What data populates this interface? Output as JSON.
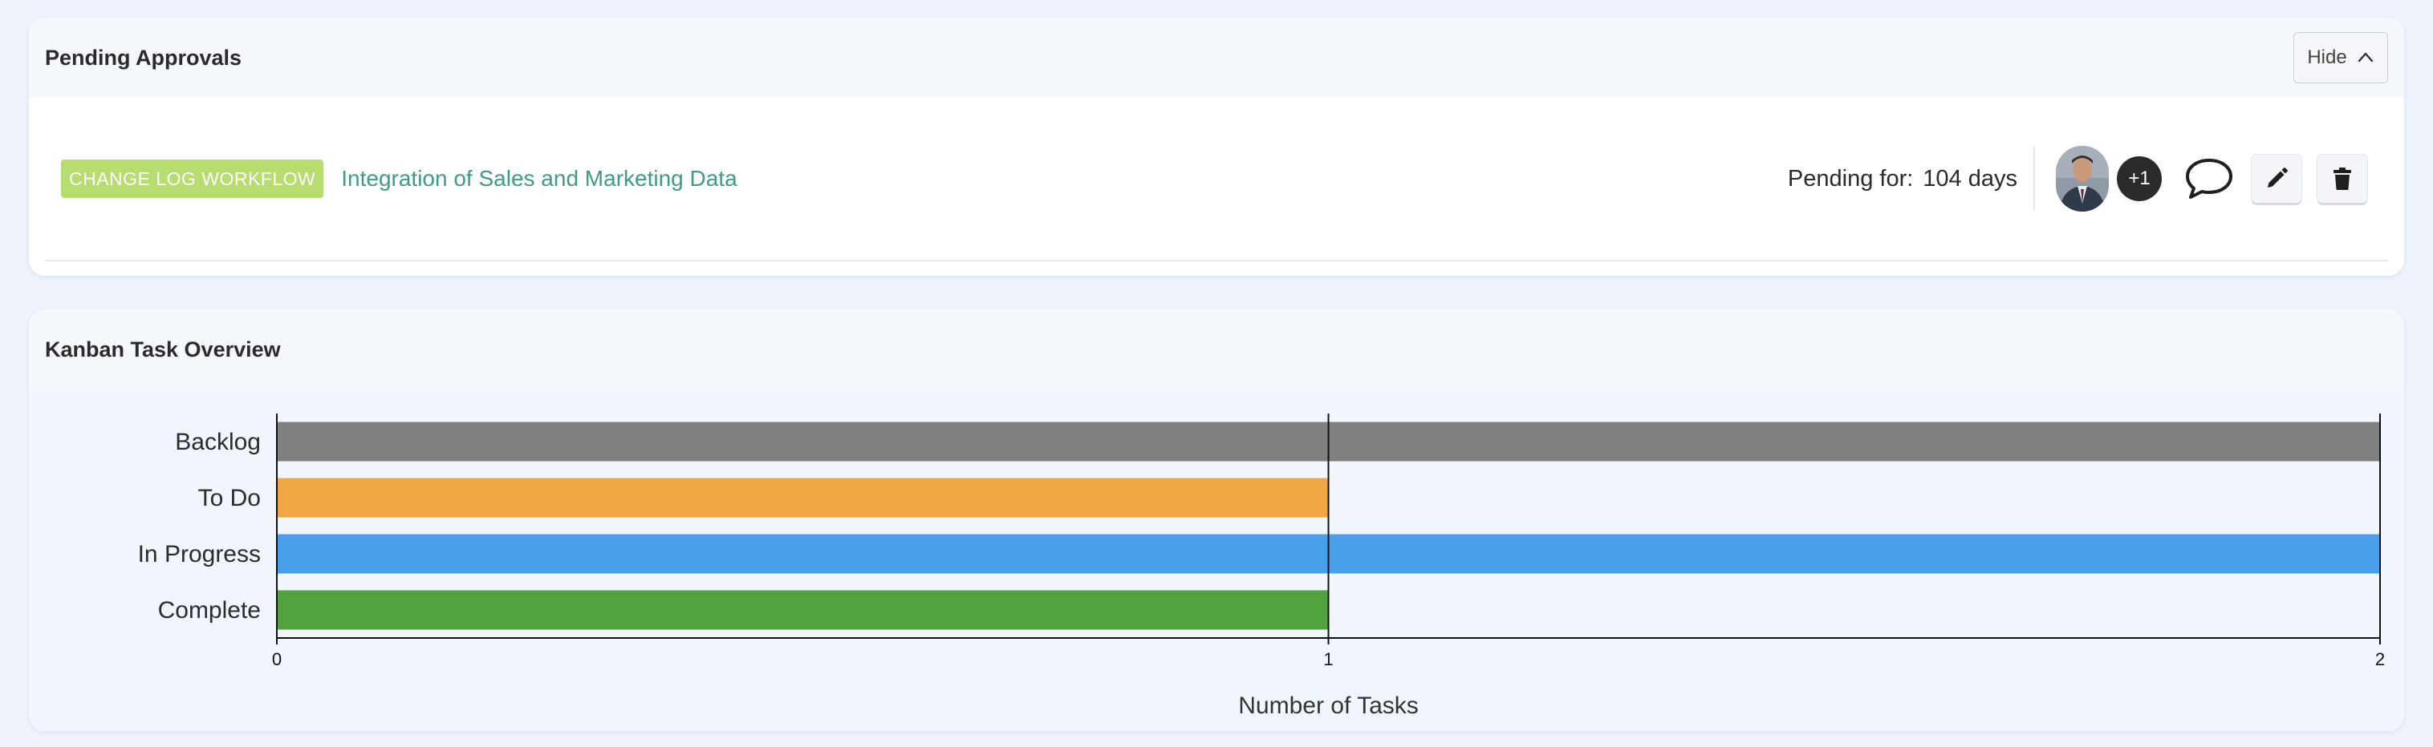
{
  "approvals": {
    "title": "Pending Approvals",
    "hide_label": "Hide",
    "item": {
      "badge": "CHANGE LOG WORKFLOW",
      "name": "Integration of Sales and Marketing Data",
      "pending_label": "Pending for:",
      "pending_value": "104 days",
      "extra_assignees": "+1",
      "avatar_icon": "user-photo-icon",
      "comment_icon": "speech-bubble-icon",
      "edit_icon": "pencil-icon",
      "delete_icon": "trash-icon"
    },
    "colors": {
      "badge": "#b7dc6f",
      "link": "#3f9a86"
    }
  },
  "kanban": {
    "title": "Kanban Task Overview"
  },
  "chart_data": {
    "type": "bar",
    "orientation": "horizontal",
    "categories": [
      "Backlog",
      "To Do",
      "In Progress",
      "Complete"
    ],
    "values": [
      2,
      1,
      2,
      1
    ],
    "colors": [
      "#808080",
      "#f2a745",
      "#4a9fea",
      "#52a33f"
    ],
    "xlabel": "Number of Tasks",
    "ylabel": "",
    "xlim": [
      0,
      2
    ],
    "xticks": [
      "0",
      "1",
      "2"
    ],
    "grid": true
  }
}
